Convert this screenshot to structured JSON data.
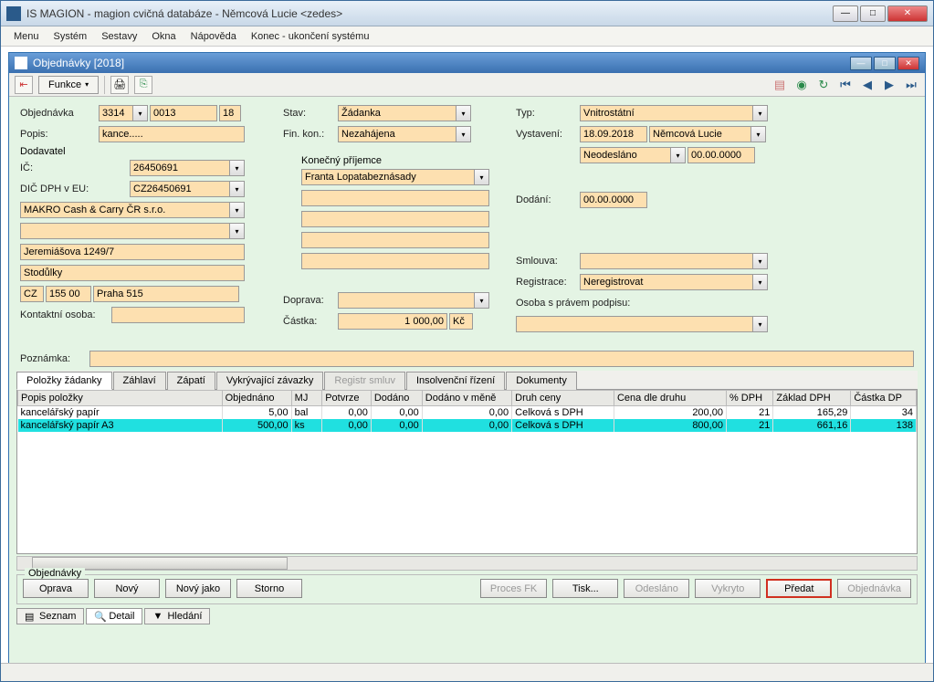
{
  "outerWindow": {
    "title": "IS MAGION - magion cvičná databáze - Němcová Lucie <zedes>"
  },
  "menubar": {
    "items": [
      "Menu",
      "Systém",
      "Sestavy",
      "Okna",
      "Nápověda",
      "Konec - ukončení systému"
    ]
  },
  "innerWindow": {
    "title": "Objednávky [2018]"
  },
  "toolbar": {
    "funkce": "Funkce"
  },
  "form": {
    "objednavka_label": "Objednávka",
    "objednavka_series": "3314",
    "objednavka_num": "0013",
    "objednavka_year": "18",
    "popis_label": "Popis:",
    "popis_value": "kance.....",
    "dodavatel_label": "Dodavatel",
    "ic_label": "IČ:",
    "ic_value": "26450691",
    "dic_label": "DIČ DPH v EU:",
    "dic_value": "CZ26450691",
    "dodavatel_name": "MAKRO Cash & Carry ČR s.r.o.",
    "dodavatel_empty": "",
    "ulice": "Jeremiášova 1249/7",
    "mesto": "Stodůlky",
    "zeme": "CZ",
    "psc": "155 00",
    "posta": "Praha 515",
    "kontakt_label": "Kontaktní osoba:",
    "kontakt_value": "",
    "poznamka_label": "Poznámka:",
    "poznamka_value": "",
    "stav_label": "Stav:",
    "stav_value": "Žádanka",
    "finkon_label": "Fin. kon.:",
    "finkon_value": "Nezahájena",
    "prijemce_label": "Konečný příjemce",
    "prijemce_value": "Franta Lopatabeznásady",
    "doprava_label": "Doprava:",
    "doprava_value": "",
    "castka_label": "Částka:",
    "castka_value": "1 000,00",
    "castka_curr": "Kč",
    "typ_label": "Typ:",
    "typ_value": "Vnitrostátní",
    "vystaveni_label": "Vystavení:",
    "vystaveni_date": "18.09.2018",
    "vystaveni_user": "Němcová Lucie",
    "odeslano_value": "Neodesláno",
    "odeslano_date": "00.00.0000",
    "dodani_label": "Dodání:",
    "dodani_value": "00.00.0000",
    "smlouva_label": "Smlouva:",
    "smlouva_value": "",
    "registrace_label": "Registrace:",
    "registrace_value": "Neregistrovat",
    "osoba_label": "Osoba s právem podpisu:",
    "osoba_value": ""
  },
  "tabs": {
    "items": [
      "Položky žádanky",
      "Záhlaví",
      "Zápatí",
      "Vykrývající závazky",
      "Registr smluv",
      "Insolvenční řízení",
      "Dokumenty"
    ],
    "active": 0,
    "disabled": [
      4
    ]
  },
  "grid": {
    "columns": [
      "Popis položky",
      "Objednáno",
      "MJ",
      "Potvrze",
      "Dodáno",
      "Dodáno v měně",
      "Druh ceny",
      "Cena dle druhu",
      "% DPH",
      "Základ DPH",
      "Částka DP"
    ],
    "rows": [
      {
        "popis": "kancelářský papír",
        "obj": "5,00",
        "mj": "bal",
        "potvr": "0,00",
        "dodano": "0,00",
        "dodmena": "0,00",
        "druh": "Celková s DPH",
        "cena": "200,00",
        "dph": "21",
        "zaklad": "165,29",
        "castka": "34"
      },
      {
        "popis": "kancelářský papír A3",
        "obj": "500,00",
        "mj": "ks",
        "potvr": "0,00",
        "dodano": "0,00",
        "dodmena": "0,00",
        "druh": "Celková s DPH",
        "cena": "800,00",
        "dph": "21",
        "zaklad": "661,16",
        "castka": "138"
      }
    ]
  },
  "bottomPanel": {
    "legend": "Objednávky",
    "buttons": {
      "oprava": "Oprava",
      "novy": "Nový",
      "novyjako": "Nový jako",
      "storno": "Storno",
      "procesfk": "Proces FK",
      "tisk": "Tisk...",
      "odeslano": "Odesláno",
      "vykryto": "Vykryto",
      "predat": "Předat",
      "objednavka": "Objednávka"
    }
  },
  "bottomTabs": {
    "items": [
      "Seznam",
      "Detail",
      "Hledání"
    ],
    "active": 1
  }
}
